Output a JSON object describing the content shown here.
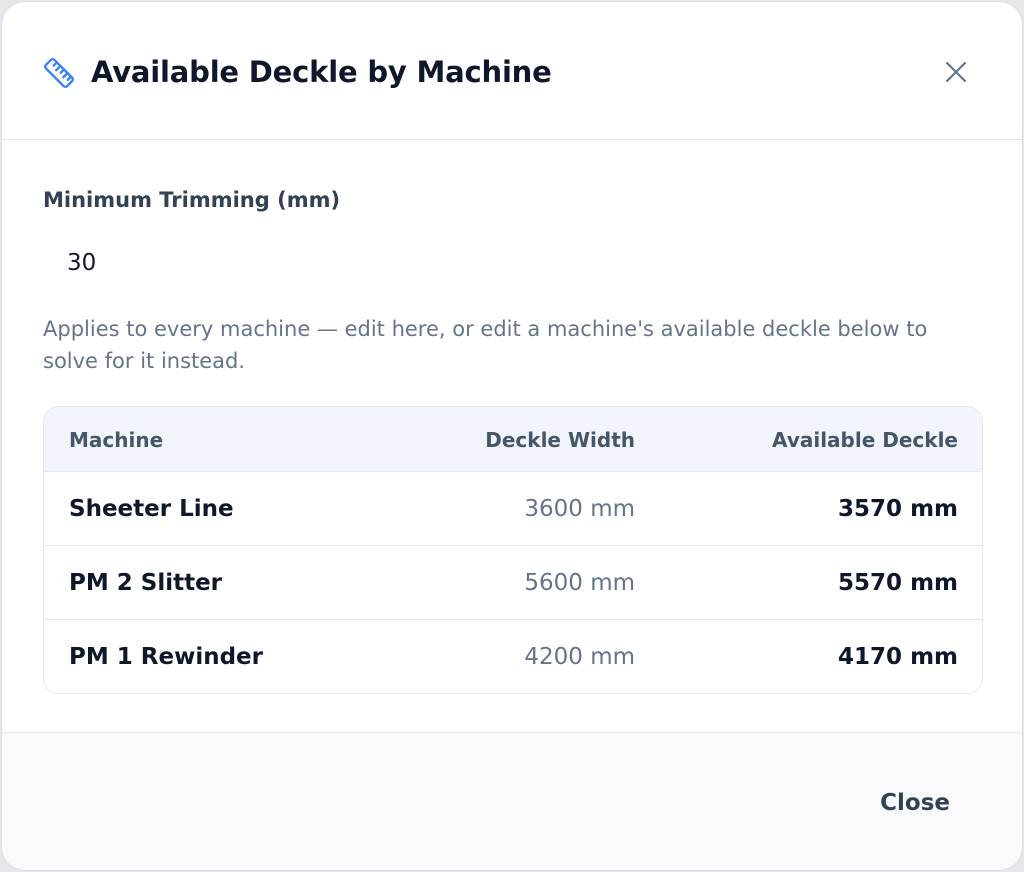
{
  "dialog": {
    "title": "Available Deckle by Machine",
    "icon": "ruler-icon",
    "close_icon": "close-icon"
  },
  "trimming": {
    "label": "Minimum Trimming (mm)",
    "value": "30",
    "help": "Applies to every machine — edit here, or edit a machine's available deckle below to solve for it instead."
  },
  "table": {
    "headers": {
      "machine": "Machine",
      "deckle_width": "Deckle Width",
      "available_deckle": "Available Deckle"
    },
    "rows": [
      {
        "machine": "Sheeter Line",
        "deckle_width": "3600 mm",
        "available_deckle": "3570 mm"
      },
      {
        "machine": "PM 2 Slitter",
        "deckle_width": "5600 mm",
        "available_deckle": "5570 mm"
      },
      {
        "machine": "PM 1 Rewinder",
        "deckle_width": "4200 mm",
        "available_deckle": "4170 mm"
      }
    ]
  },
  "footer": {
    "close_label": "Close"
  },
  "colors": {
    "accent": "#3b82f6",
    "title": "#0f172a",
    "muted": "#64748b"
  }
}
